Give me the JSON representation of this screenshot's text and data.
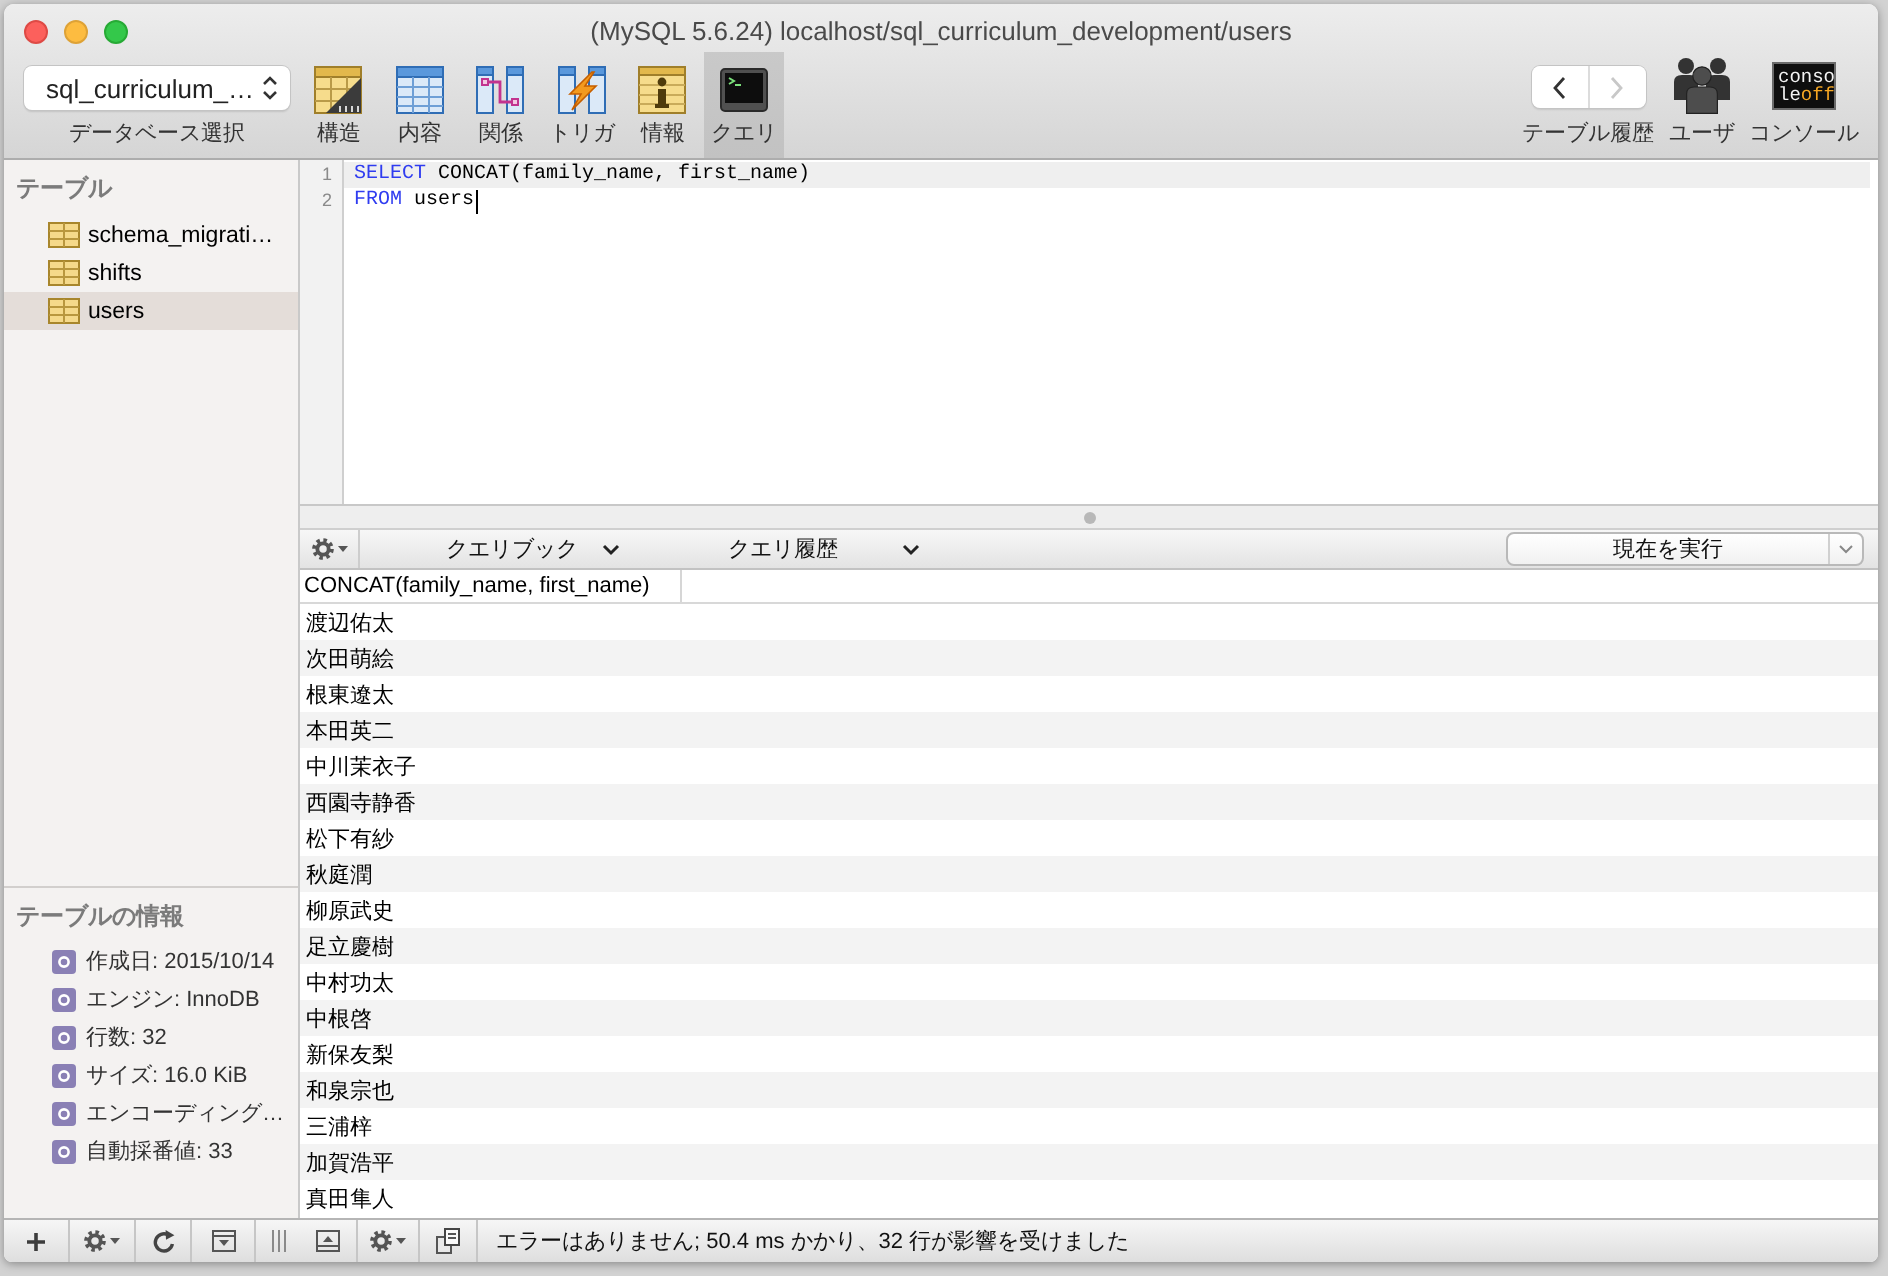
{
  "window": {
    "title": "(MySQL 5.6.24) localhost/sql_curriculum_development/users"
  },
  "toolbar": {
    "database_select": {
      "value": "sql_curriculum_…",
      "label": "データベース選択"
    },
    "views": [
      {
        "kind": "structure",
        "label": "構造",
        "selected": false
      },
      {
        "kind": "content",
        "label": "内容",
        "selected": false
      },
      {
        "kind": "relations",
        "label": "関係",
        "selected": false
      },
      {
        "kind": "triggers",
        "label": "トリガ",
        "selected": false
      },
      {
        "kind": "info",
        "label": "情報",
        "selected": false
      },
      {
        "kind": "query",
        "label": "クエリ",
        "selected": true
      }
    ],
    "history": {
      "label": "テーブル履歴",
      "back": {
        "disabled": false
      },
      "forward": {
        "disabled": true
      }
    },
    "users": {
      "label": "ユーザ"
    },
    "console": {
      "label": "コンソール",
      "icon_lines": [
        [
          {
            "text": "conso",
            "accent": false
          }
        ],
        [
          {
            "text": "le",
            "accent": false
          },
          {
            "text": "off",
            "accent": true
          }
        ]
      ]
    }
  },
  "sidebar": {
    "heading": "テーブル",
    "tables": [
      {
        "name": "schema_migrati…",
        "selected": false
      },
      {
        "name": "shifts",
        "selected": false
      },
      {
        "name": "users",
        "selected": true
      }
    ],
    "info_heading": "テーブルの情報",
    "info": [
      "作成日: 2015/10/14",
      "エンジン: InnoDB",
      "行数: 32",
      "サイズ: 16.0 KiB",
      "エンコーディング…",
      "自動採番値: 33"
    ]
  },
  "editor": {
    "lines": [
      {
        "number": "1",
        "highlighted": true,
        "caret": false,
        "tokens": [
          {
            "kind": "keyword",
            "text": "SELECT"
          },
          {
            "kind": "plain",
            "text": " CONCAT(family_name, first_name)"
          }
        ]
      },
      {
        "number": "2",
        "highlighted": false,
        "caret": true,
        "tokens": [
          {
            "kind": "keyword",
            "text": "FROM"
          },
          {
            "kind": "plain",
            "text": " users"
          }
        ]
      }
    ]
  },
  "query_bar": {
    "favorites": "クエリブック",
    "history": "クエリ履歴",
    "run": "現在を実行"
  },
  "results": {
    "columns": [
      "CONCAT(family_name, first_name)"
    ],
    "rows": [
      [
        "渡辺佑太"
      ],
      [
        "次田萌絵"
      ],
      [
        "根東遼太"
      ],
      [
        "本田英二"
      ],
      [
        "中川茉衣子"
      ],
      [
        "西園寺静香"
      ],
      [
        "松下有紗"
      ],
      [
        "秋庭潤"
      ],
      [
        "柳原武史"
      ],
      [
        "足立慶樹"
      ],
      [
        "中村功太"
      ],
      [
        "中根啓"
      ],
      [
        "新保友梨"
      ],
      [
        "和泉宗也"
      ],
      [
        "三浦梓"
      ],
      [
        "加賀浩平"
      ],
      [
        "真田隼人"
      ]
    ]
  },
  "status_bar": {
    "message": "エラーはありません; 50.4 ms かかり、32 行が影響を受けました"
  }
}
